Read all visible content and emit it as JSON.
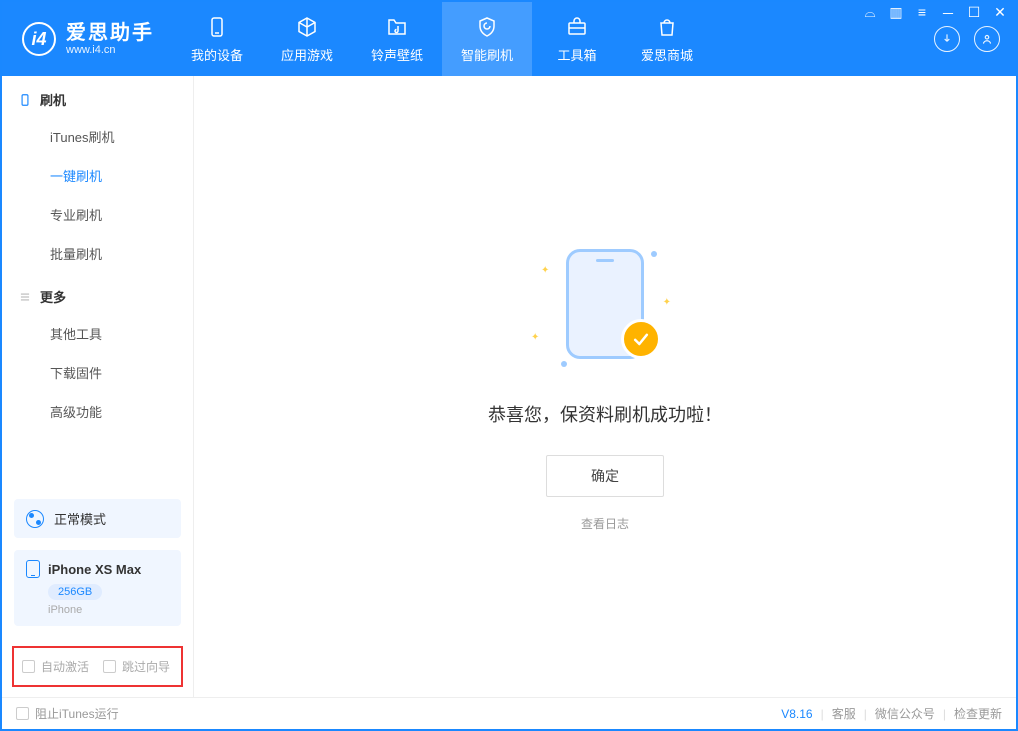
{
  "app": {
    "name_cn": "爱思助手",
    "name_en": "www.i4.cn"
  },
  "tabs": {
    "device": "我的设备",
    "apps": "应用游戏",
    "ringtone": "铃声壁纸",
    "flash": "智能刷机",
    "toolbox": "工具箱",
    "store": "爱思商城"
  },
  "sidebar": {
    "section_flash": "刷机",
    "items_flash": {
      "itunes": "iTunes刷机",
      "oneclick": "一键刷机",
      "pro": "专业刷机",
      "batch": "批量刷机"
    },
    "section_more": "更多",
    "items_more": {
      "other": "其他工具",
      "firmware": "下载固件",
      "advanced": "高级功能"
    },
    "mode": "正常模式",
    "device_name": "iPhone XS Max",
    "device_storage": "256GB",
    "device_type": "iPhone",
    "chk_activate": "自动激活",
    "chk_skip": "跳过向导"
  },
  "main": {
    "message": "恭喜您，保资料刷机成功啦！",
    "ok": "确定",
    "view_log": "查看日志"
  },
  "status": {
    "block_itunes": "阻止iTunes运行",
    "version": "V8.16",
    "support": "客服",
    "wechat": "微信公众号",
    "update": "检查更新"
  }
}
